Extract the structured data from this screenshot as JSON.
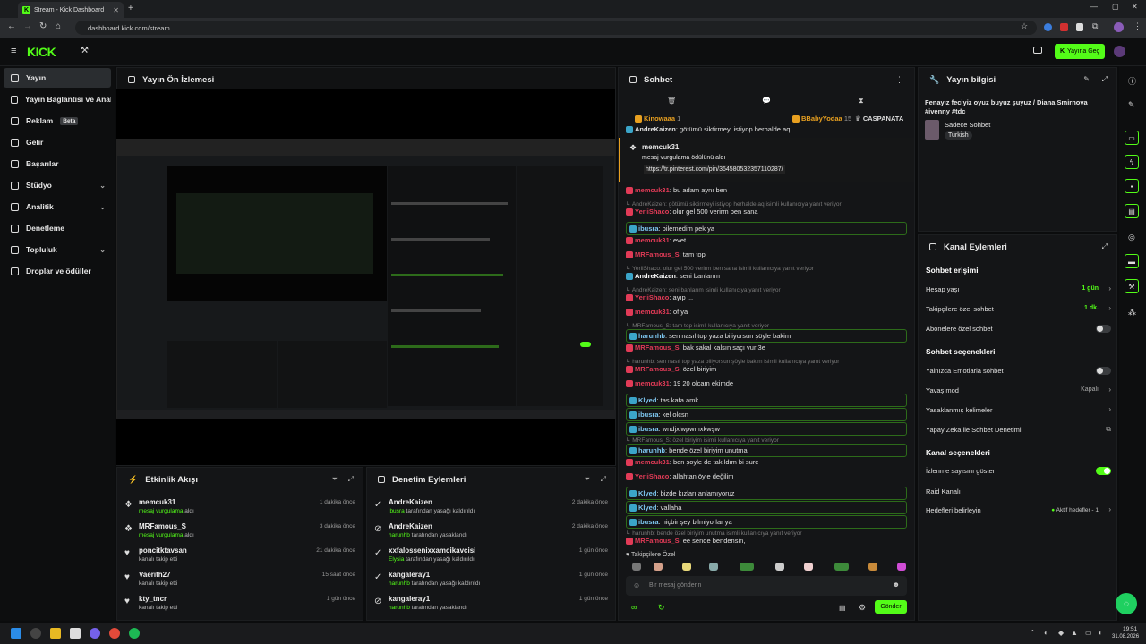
{
  "browser": {
    "tab_title": "Stream - Kick Dashboard",
    "url": "dashboard.kick.com/stream"
  },
  "topnav": {
    "logo": "KICK",
    "go_live_label": "Yayına Geç"
  },
  "sidebar": {
    "items": [
      {
        "label": "Yayın",
        "active": true
      },
      {
        "label": "Yayın Bağlantısı ve Anahtarı"
      },
      {
        "label": "Reklam",
        "badge": "Beta"
      },
      {
        "label": "Gelir"
      },
      {
        "label": "Başarılar"
      },
      {
        "label": "Stüdyo",
        "expandable": true
      },
      {
        "label": "Analitik",
        "expandable": true
      },
      {
        "label": "Denetleme"
      },
      {
        "label": "Topluluk",
        "expandable": true
      },
      {
        "label": "Droplar ve ödüller"
      }
    ]
  },
  "preview": {
    "title": "Yayın Ön İzlemesi"
  },
  "activity": {
    "title": "Etkinlik Akışı",
    "items": [
      {
        "name": "memcuk31",
        "highlight": "mesaj vurgulama",
        "rest": " aldı",
        "time": "1 dakika önce",
        "icon": "gift-icon"
      },
      {
        "name": "MRFamous_S",
        "highlight": "mesaj vurgulama",
        "rest": " aldı",
        "time": "3 dakika önce",
        "icon": "gift-icon"
      },
      {
        "name": "poncitktavsan",
        "highlight": "",
        "rest": "kanalı takip etti",
        "time": "21 dakika önce",
        "icon": "heart-icon"
      },
      {
        "name": "Vaerith27",
        "highlight": "",
        "rest": "kanalı takip etti",
        "time": "15 saat önce",
        "icon": "heart-icon"
      },
      {
        "name": "kty_tncr",
        "highlight": "",
        "rest": "kanalı takip etti",
        "time": "1 gün önce",
        "icon": "heart-icon"
      }
    ]
  },
  "moderation": {
    "title": "Denetim Eylemleri",
    "items": [
      {
        "name": "AndreKaizen",
        "by": "ibusra",
        "rest": " tarafından yasağı kaldırıldı",
        "time": "2 dakika önce"
      },
      {
        "name": "AndreKaizen",
        "by": "harunhb",
        "rest": " tarafından yasaklandı",
        "time": "2 dakika önce"
      },
      {
        "name": "xxfalossenixxamcikavcisi",
        "by": "Elysia",
        "rest": " tarafından yasağı kaldırıldı",
        "time": "1 gün önce"
      },
      {
        "name": "kangaleray1",
        "by": "harunhb",
        "rest": " tarafından yasağı kaldırıldı",
        "time": "1 gün önce"
      },
      {
        "name": "kangaleray1",
        "by": "harunhb",
        "rest": " tarafından yasaklandı",
        "time": "1 gün önce"
      }
    ]
  },
  "chat": {
    "title": "Sohbet",
    "pinned": [
      {
        "name": "Kinowaaa",
        "count": "1"
      },
      {
        "name": "BBabyYodaa",
        "count": "15"
      },
      {
        "name": "CASPANATA",
        "count": ""
      }
    ],
    "top_line": {
      "user": "AndreKaizen",
      "text": ": götümü siktirmeyi istiyop herhalde aq"
    },
    "highlight": {
      "user": "memcuk31",
      "text": "mesaj vurgulama ödülünü aldı",
      "link": "https://tr.pinterest.com/pin/36458053235711028​7/"
    },
    "messages": [
      {
        "reply": "",
        "user": "memcuk31",
        "color": "#e23b57",
        "text": ": bu adam aynı ben",
        "boxed": false
      },
      {
        "reply": "↳ AndreKaizen: götümü siktirmeyi istiyop herhalde aq isimli kullanıcıya yanıt veriyor",
        "user": "YeriiShaco",
        "color": "#e23b57",
        "text": ": olur gel 500 verirm ben sana",
        "boxed": false
      },
      {
        "reply": "",
        "user": "ibusra",
        "color": "#7ec8f2",
        "text": ": bilemedim pek ya",
        "boxed": true
      },
      {
        "reply": "",
        "user": "memcuk31",
        "color": "#e23b57",
        "text": ": evet",
        "boxed": false
      },
      {
        "reply": "",
        "user": "MRFamous_S",
        "color": "#e23b57",
        "text": ": tam top",
        "boxed": false
      },
      {
        "reply": "↳ YeriiShaco: olur gel 500 verirm ben sana isimli kullanıcıya yanıt veriyor",
        "user": "AndreKaizen",
        "color": "#ffffff",
        "text": ": seni banlarım",
        "boxed": false
      },
      {
        "reply": "↳ AndreKaizen: seni banlarım isimli kullanıcıya yanıt veriyor",
        "user": "YeriiShaco",
        "color": "#e23b57",
        "text": ": ayıp ...",
        "boxed": false
      },
      {
        "reply": "",
        "user": "memcuk31",
        "color": "#e23b57",
        "text": ": of ya",
        "boxed": false
      },
      {
        "reply": "↳ MRFamous_S: tam top isimli kullanıcıya yanıt veriyor",
        "user": "harunhb",
        "color": "#7ec8f2",
        "text": ": sen nasıl top yaza biliyorsun şöyle bakim",
        "boxed": true
      },
      {
        "reply": "",
        "user": "MRFamous_S",
        "color": "#e23b57",
        "text": ": bak sakal kalsın saçı vur 3e",
        "boxed": false
      },
      {
        "reply": "↳ harunhb: sen nasıl top yaza biliyorsun şöyle bakim isimli kullanıcıya yanıt veriyor",
        "user": "MRFamous_S",
        "color": "#e23b57",
        "text": ": özel biriyim",
        "boxed": false
      },
      {
        "reply": "",
        "user": "memcuk31",
        "color": "#e23b57",
        "text": ": 19 20 olcam ekimde",
        "boxed": false
      },
      {
        "reply": "",
        "user": "Klyed",
        "color": "#7ec8f2",
        "text": ": tas kafa amk",
        "boxed": true
      },
      {
        "reply": "",
        "user": "ibusra",
        "color": "#7ec8f2",
        "text": ": kel olcsn",
        "boxed": true
      },
      {
        "reply": "",
        "user": "ibusra",
        "color": "#7ec8f2",
        "text": ": wndjxlwpwmxkwşw",
        "boxed": true
      },
      {
        "reply": "↳ MRFamous_S: özel biriyim isimli kullanıcıya yanıt veriyor",
        "user": "harunhb",
        "color": "#7ec8f2",
        "text": ": bende özel biriyim unutma",
        "boxed": true
      },
      {
        "reply": "",
        "user": "memcuk31",
        "color": "#e23b57",
        "text": ": ben şoyle de takıldım bi sure",
        "boxed": false
      },
      {
        "reply": "",
        "user": "YeriiShaco",
        "color": "#e23b57",
        "text": ": allahtan öyle değilim",
        "boxed": false
      },
      {
        "reply": "",
        "user": "Klyed",
        "color": "#7ec8f2",
        "text": ": bizde kızları anlamıyoruz",
        "boxed": true
      },
      {
        "reply": "",
        "user": "Klyed",
        "color": "#7ec8f2",
        "text": ": vallaha",
        "boxed": true
      },
      {
        "reply": "",
        "user": "ibusra",
        "color": "#7ec8f2",
        "text": ": hiçbir şey bilmiyorlar ya",
        "boxed": true
      },
      {
        "reply": "↳ harunhb: bende özel biriyim unutma isimli kullanıcıya yanıt veriyor",
        "user": "MRFamous_S",
        "color": "#e23b57",
        "text": ": ee sende bendensin,",
        "boxed": false
      }
    ],
    "followers_only": "Takipçilere Özel",
    "input_placeholder": "Bir mesaj gönderin",
    "send_label": "Gönder"
  },
  "stream_info": {
    "title": "Yayın bilgisi",
    "stream_title": "Fenayız feciyiz oyuz buyuz şuyuz / Diana Smirnova #ivenny #tdc",
    "category": "Sadece Sohbet",
    "language": "Turkish"
  },
  "channel_actions": {
    "title": "Kanal Eylemleri",
    "chat_access": "Sohbet erişimi",
    "account_age": {
      "label": "Hesap yaşı",
      "value": "1 gün"
    },
    "followers_chat": {
      "label": "Takipçilere özel sohbet",
      "value": "1 dk."
    },
    "subs_chat": "Abonelere özel sohbet",
    "chat_options": "Sohbet seçenekleri",
    "emote_only": "Yalnızca Emotlarla sohbet",
    "slow_mode": {
      "label": "Yavaş mod",
      "value": "Kapalı"
    },
    "banned_words": "Yasaklanmış kelimeler",
    "ai_moderation": "Yapay Zeka ile Sohbet Denetimi",
    "channel_options": "Kanal seçenekleri",
    "show_viewers": "İzlenme sayısını göster",
    "raid": "Raid Kanalı",
    "set_goals": {
      "label": "Hedefleri belirleyin",
      "value": "Aktif hedefler - 1"
    }
  },
  "taskbar": {
    "time": "19:51",
    "date": "31.08.2026"
  },
  "colors": {
    "accent": "#53fc18",
    "bg": "#0b0c0d",
    "panel": "#141517"
  }
}
